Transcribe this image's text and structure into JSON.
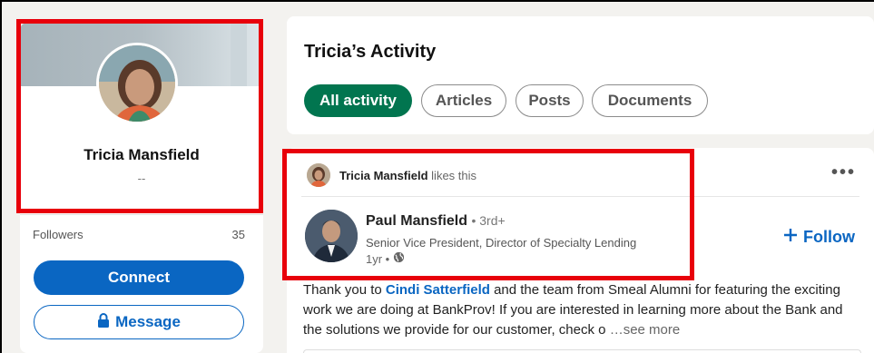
{
  "profile": {
    "name": "Tricia Mansfield",
    "headline": "--",
    "followers_label": "Followers",
    "followers_count": "35",
    "connect_label": "Connect",
    "message_label": "Message"
  },
  "activity": {
    "title": "Tricia’s Activity",
    "tabs": [
      {
        "label": "All activity",
        "active": true
      },
      {
        "label": "Articles",
        "active": false
      },
      {
        "label": "Posts",
        "active": false
      },
      {
        "label": "Documents",
        "active": false
      }
    ]
  },
  "post": {
    "liker_name": "Tricia Mansfield",
    "liker_action": "likes this",
    "author_name": "Paul Mansfield",
    "author_degree": "• 3rd+",
    "author_title": "Senior Vice President, Director of Specialty Lending",
    "time": "1yr •",
    "follow_label": "Follow",
    "body_pre": "Thank you to ",
    "body_mention": "Cindi Satterfield",
    "body_post": " and the team from Smeal Alumni for featuring the exciting work we are doing at BankProv! If you are interested in learning more about the Bank and the solutions we provide for our customer, check o",
    "see_more": "…see more"
  },
  "icons": {
    "more": "more-horizontal-icon",
    "follow": "plus-icon",
    "message": "lock-icon",
    "visibility": "globe-icon"
  },
  "colors": {
    "accent": "#0a66c2",
    "active_tab": "#01754f",
    "highlight": "#e8000b"
  }
}
